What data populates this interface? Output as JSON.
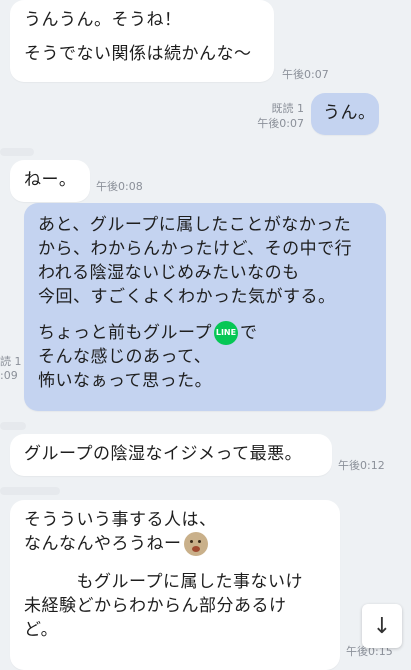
{
  "messages": [
    {
      "side": "left",
      "lines": [
        "うんうん。そうね！",
        "",
        "そうでない関係は続かんな〜"
      ],
      "time": "午後0:07"
    },
    {
      "side": "right",
      "lines": [
        "うん。"
      ],
      "read": "既読 1",
      "time": "午後0:07"
    },
    {
      "side": "left",
      "lines": [
        "ねー。"
      ],
      "time": "午後0:08"
    },
    {
      "side": "right",
      "lines": [
        "あと、グループに属したことがなかった",
        "から、わからんかったけど、その中で行",
        "われる陰湿ないじめみたいなのも",
        "今回、すごくよくわかった気がする。",
        ""
      ],
      "line_a_pre": "ちょっと前もグループ",
      "badge": "LINE",
      "line_a_post": "で",
      "lines_after": [
        "そんな感じのあって、",
        "怖いなぁって思った。"
      ],
      "read": "読 1",
      "time": ":09"
    },
    {
      "side": "left",
      "lines": [
        "グループの陰湿なイジメって最悪。"
      ],
      "time": "午後0:12"
    },
    {
      "side": "left",
      "line_b": "そうういう事する人は、",
      "line_c_pre": "なんなんやろうねー",
      "lines_after": [
        "",
        "　　　もグループに属した事ないけ",
        "未経験どからわからん部分あるけ",
        "ど。"
      ],
      "time": "午後0:15"
    }
  ],
  "scroll_button_icon": "arrow-down-icon",
  "scroll_button_glyph": "↓"
}
